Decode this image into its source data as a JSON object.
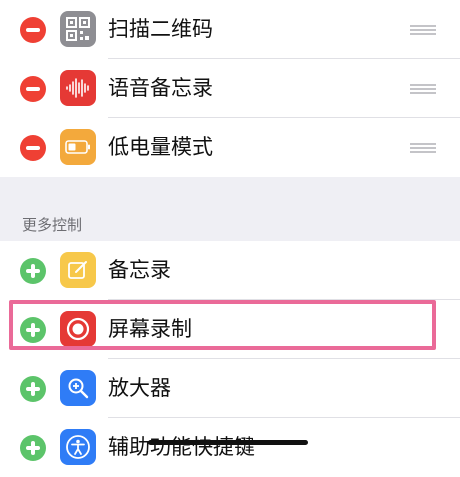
{
  "sections": {
    "included": {
      "items": [
        {
          "label": "扫描二维码",
          "icon": "qr-code-icon",
          "icon_bg": "#8e8e93"
        },
        {
          "label": "语音备忘录",
          "icon": "voice-memo-waveform-icon",
          "icon_bg": "#e53935"
        },
        {
          "label": "低电量模式",
          "icon": "battery-icon",
          "icon_bg": "#f3a93c"
        }
      ]
    },
    "more_controls": {
      "header": "更多控制",
      "items": [
        {
          "label": "备忘录",
          "icon": "notes-icon",
          "icon_bg": "#f7c84a"
        },
        {
          "label": "屏幕录制",
          "icon": "screen-record-icon",
          "icon_bg": "#e53935"
        },
        {
          "label": "放大器",
          "icon": "magnifier-icon",
          "icon_bg": "#2f7cf6"
        },
        {
          "label": "辅助功能快捷键",
          "icon": "accessibility-icon",
          "icon_bg": "#2f7cf6"
        }
      ]
    }
  },
  "colors": {
    "remove": "#ef4034",
    "add": "#5cc46a",
    "highlight": "#ea6a98",
    "background": "#efeff4"
  }
}
